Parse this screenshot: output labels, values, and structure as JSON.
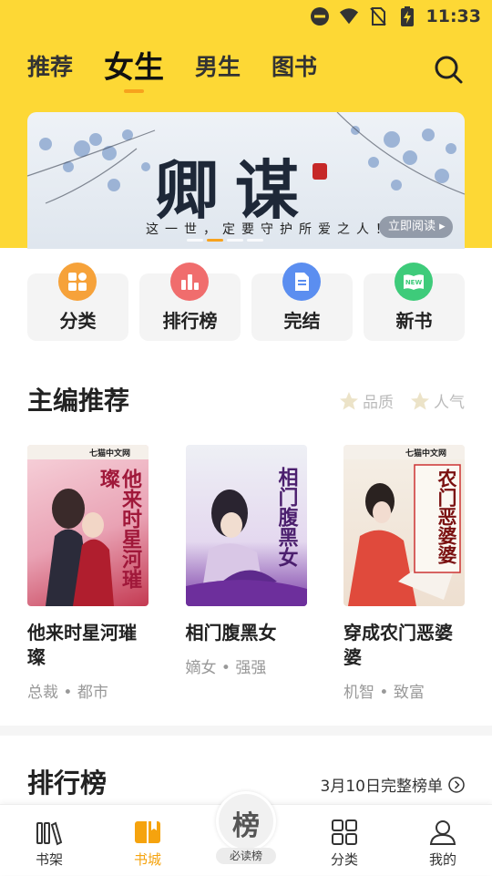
{
  "status_bar": {
    "time": "11:33"
  },
  "top_tabs": [
    {
      "label": "推荐",
      "active": false
    },
    {
      "label": "女生",
      "active": true
    },
    {
      "label": "男生",
      "active": false
    },
    {
      "label": "图书",
      "active": false
    }
  ],
  "banner": {
    "title": "卿谋",
    "subtitle": "这一世，定要守护所爱之人！",
    "read_button": "立即阅读"
  },
  "categories": [
    {
      "label": "分类",
      "icon": "category-grid-icon",
      "color": "#f6a23a"
    },
    {
      "label": "排行榜",
      "icon": "bar-chart-icon",
      "color": "#f06d6d"
    },
    {
      "label": "完结",
      "icon": "document-icon",
      "color": "#5b8ef0"
    },
    {
      "label": "新书",
      "icon": "new-book-icon",
      "color": "#3ecb7a"
    }
  ],
  "editor_picks": {
    "title": "主编推荐",
    "filters": [
      "品质",
      "人气"
    ],
    "books": [
      {
        "title": "他来时星河璀璨",
        "tags": "总裁 • 都市",
        "cover_text": "他来时星河璀璨",
        "cover_brand": "七猫中文网"
      },
      {
        "title": "相门腹黑女",
        "tags": "嫡女 • 强强",
        "cover_text": "相门腹黑女",
        "cover_brand": ""
      },
      {
        "title": "穿成农门恶婆婆",
        "tags": "机智 • 致富",
        "cover_text": "农门恶婆婆",
        "cover_brand": "七猫中文网"
      }
    ]
  },
  "ranking": {
    "title": "排行榜",
    "link": "3月10日完整榜单"
  },
  "bottom_nav": {
    "items": [
      {
        "label": "书架",
        "icon": "bookshelf-icon",
        "active": false
      },
      {
        "label": "书城",
        "icon": "book-store-icon",
        "active": true
      },
      {
        "label": "分类",
        "icon": "grid-icon",
        "active": false
      },
      {
        "label": "我的",
        "icon": "profile-icon",
        "active": false
      }
    ],
    "center": {
      "big": "榜",
      "small": "必读榜"
    }
  },
  "colors": {
    "header_yellow": "#fdd835",
    "accent_orange": "#f5a30e"
  }
}
